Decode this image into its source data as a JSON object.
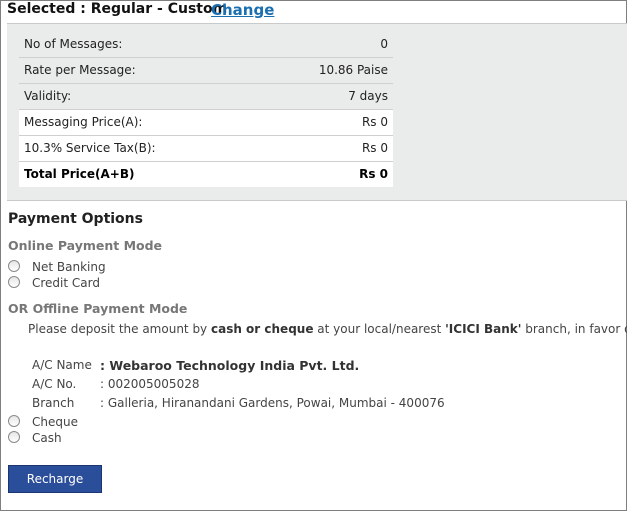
{
  "header": {
    "selected_label": "Selected : Regular - Custom",
    "change_link": "Change"
  },
  "summary": {
    "rows": [
      {
        "label": "No of Messages:",
        "value": "0"
      },
      {
        "label": "Rate per Message:",
        "value": "10.86 Paise"
      },
      {
        "label": "Validity:",
        "value": "7 days"
      },
      {
        "label": "Messaging Price(A):",
        "value": "Rs 0"
      },
      {
        "label": "10.3% Service Tax(B):",
        "value": "Rs 0"
      },
      {
        "label": "Total Price(A+B)",
        "value": "Rs 0"
      }
    ]
  },
  "payment": {
    "title": "Payment Options",
    "online_title": "Online Payment Mode",
    "online_options": [
      "Net Banking",
      "Credit Card"
    ],
    "offline_title": "OR Offline Payment Mode",
    "deposit": {
      "prefix": "Please deposit the amount by ",
      "method": "cash or cheque",
      "middle": " at your local/nearest ",
      "bank": "'ICICI Bank'",
      "suffix": " branch, in favor of :"
    },
    "bank_details": {
      "name_label": "A/C Name",
      "name_value": ": Webaroo Technology India Pvt. Ltd.",
      "number_label": "A/C No.",
      "number_value": ": 002005005028",
      "branch_label": "Branch",
      "branch_value": ": Galleria, Hiranandani Gardens, Powai, Mumbai - 400076"
    },
    "offline_options": [
      "Cheque",
      "Cash"
    ]
  },
  "actions": {
    "recharge_label": "Recharge"
  },
  "colors": {
    "link": "#1a6fb0",
    "button": "#2b4e9b",
    "panel": "#eaecec"
  }
}
